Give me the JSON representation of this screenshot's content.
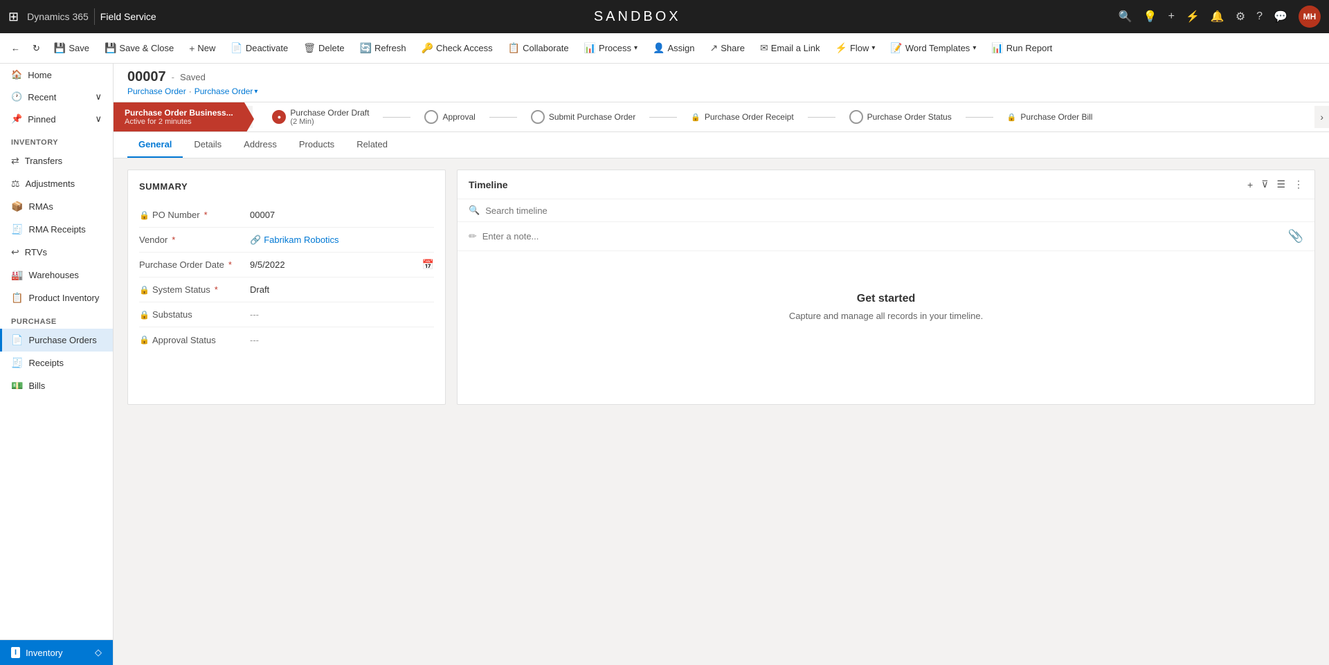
{
  "topnav": {
    "waffle": "⊞",
    "brand": "Dynamics 365",
    "separator": "|",
    "app": "Field Service",
    "sandbox_title": "SANDBOX",
    "icons": [
      "🔍",
      "💡",
      "+",
      "⚡",
      "🔔",
      "⚙",
      "?",
      "💬"
    ],
    "avatar": "MH"
  },
  "commandbar": {
    "back_icon": "←",
    "forward_icon": "↻",
    "buttons": [
      {
        "key": "save",
        "icon": "💾",
        "label": "Save"
      },
      {
        "key": "save-close",
        "icon": "💾",
        "label": "Save & Close"
      },
      {
        "key": "new",
        "icon": "+",
        "label": "New"
      },
      {
        "key": "deactivate",
        "icon": "📄",
        "label": "Deactivate"
      },
      {
        "key": "delete",
        "icon": "🗑",
        "label": "Delete"
      },
      {
        "key": "refresh",
        "icon": "🔄",
        "label": "Refresh"
      },
      {
        "key": "check-access",
        "icon": "🔑",
        "label": "Check Access"
      },
      {
        "key": "collaborate",
        "icon": "📋",
        "label": "Collaborate"
      },
      {
        "key": "process",
        "icon": "📊",
        "label": "Process",
        "has_dropdown": true
      },
      {
        "key": "assign",
        "icon": "👤",
        "label": "Assign"
      },
      {
        "key": "share",
        "icon": "↗",
        "label": "Share"
      },
      {
        "key": "email-link",
        "icon": "✉",
        "label": "Email a Link"
      },
      {
        "key": "flow",
        "icon": "⚡",
        "label": "Flow",
        "has_dropdown": true
      },
      {
        "key": "word-templates",
        "icon": "📝",
        "label": "Word Templates",
        "has_dropdown": true
      },
      {
        "key": "run-report",
        "icon": "📊",
        "label": "Run Report"
      }
    ]
  },
  "sidebar": {
    "top_items": [
      {
        "key": "home",
        "icon": "🏠",
        "label": "Home"
      },
      {
        "key": "recent",
        "icon": "🕐",
        "label": "Recent",
        "has_expand": true
      },
      {
        "key": "pinned",
        "icon": "📌",
        "label": "Pinned",
        "has_expand": true
      }
    ],
    "inventory_section": "Inventory",
    "inventory_items": [
      {
        "key": "transfers",
        "icon": "🔄",
        "label": "Transfers"
      },
      {
        "key": "adjustments",
        "icon": "⚖",
        "label": "Adjustments"
      },
      {
        "key": "rmas",
        "icon": "📦",
        "label": "RMAs"
      },
      {
        "key": "rma-receipts",
        "icon": "🧾",
        "label": "RMA Receipts"
      },
      {
        "key": "rtvs",
        "icon": "↩",
        "label": "RTVs"
      },
      {
        "key": "warehouses",
        "icon": "🏭",
        "label": "Warehouses"
      },
      {
        "key": "product-inventory",
        "icon": "📋",
        "label": "Product Inventory"
      }
    ],
    "purchase_section": "Purchase",
    "purchase_items": [
      {
        "key": "purchase-orders",
        "icon": "📄",
        "label": "Purchase Orders",
        "active": true
      },
      {
        "key": "receipts",
        "icon": "🧾",
        "label": "Receipts"
      },
      {
        "key": "bills",
        "icon": "💵",
        "label": "Bills"
      }
    ],
    "bottom_item": {
      "icon": "ℹ",
      "label": "Inventory"
    }
  },
  "record": {
    "id": "00007",
    "status": "Saved",
    "breadcrumb1": "Purchase Order",
    "breadcrumb2": "Purchase Order",
    "process_stages": [
      {
        "key": "draft",
        "label": "Purchase Order Draft",
        "sublabel": "(2 Min)",
        "active": true,
        "active_fill": true
      },
      {
        "key": "approval",
        "label": "Approval",
        "locked": false
      },
      {
        "key": "submit",
        "label": "Submit Purchase Order",
        "locked": false
      },
      {
        "key": "receipt",
        "label": "Purchase Order Receipt",
        "locked": true
      },
      {
        "key": "status",
        "label": "Purchase Order Status",
        "locked": false
      },
      {
        "key": "bill",
        "label": "Purchase Order Bill",
        "locked": true
      }
    ],
    "active_stage_name": "Purchase Order Business...",
    "active_stage_time": "Active for 2 minutes"
  },
  "tabs": [
    {
      "key": "general",
      "label": "General",
      "active": true
    },
    {
      "key": "details",
      "label": "Details"
    },
    {
      "key": "address",
      "label": "Address"
    },
    {
      "key": "products",
      "label": "Products"
    },
    {
      "key": "related",
      "label": "Related"
    }
  ],
  "summary": {
    "title": "SUMMARY",
    "fields": [
      {
        "key": "po-number",
        "icon": "🔒",
        "label": "PO Number",
        "required": true,
        "value": "00007",
        "type": "text"
      },
      {
        "key": "vendor",
        "icon": "",
        "label": "Vendor",
        "required": true,
        "value": "Fabrikam Robotics",
        "type": "link"
      },
      {
        "key": "po-date",
        "icon": "",
        "label": "Purchase Order Date",
        "required": true,
        "value": "9/5/2022",
        "type": "date"
      },
      {
        "key": "system-status",
        "icon": "🔒",
        "label": "System Status",
        "required": true,
        "value": "Draft",
        "type": "text"
      },
      {
        "key": "substatus",
        "icon": "🔒",
        "label": "Substatus",
        "required": false,
        "value": "---",
        "type": "text"
      },
      {
        "key": "approval-status",
        "icon": "🔒",
        "label": "Approval Status",
        "required": false,
        "value": "---",
        "type": "text"
      }
    ]
  },
  "timeline": {
    "title": "Timeline",
    "search_placeholder": "Search timeline",
    "note_placeholder": "Enter a note...",
    "empty_title": "Get started",
    "empty_desc": "Capture and manage all records in your timeline."
  }
}
